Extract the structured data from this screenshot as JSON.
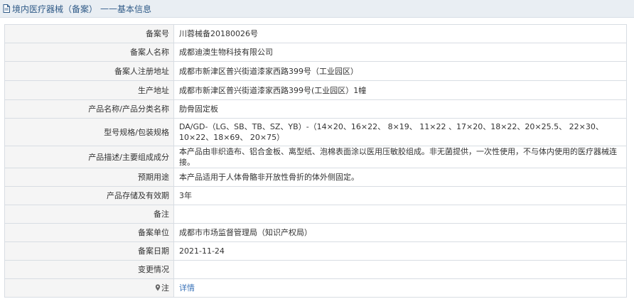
{
  "header": {
    "section": "境内医疗器械（备案）",
    "separator": "——",
    "subtitle": "基本信息"
  },
  "rows": [
    {
      "label": "备案号",
      "value": "川蓉械备20180026号"
    },
    {
      "label": "备案人名称",
      "value": "成都迪澳生物科技有限公司"
    },
    {
      "label": "备案人注册地址",
      "value": "成都市新津区普兴街道漆家西路399号（工业园区）"
    },
    {
      "label": "生产地址",
      "value": "成都市新津区普兴街道漆家西路399号(工业园区）1幢"
    },
    {
      "label": "产品名称/产品分类名称",
      "value": "肋骨固定板"
    },
    {
      "label": "型号规格/包装规格",
      "value": "DA/GD-（LG、SB、TB、SZ、YB）-（14×20、16×22、 8×19、 11×22 、17×20、18×22、20×25.5、 22×30、 10×22、18×69、 20×75）"
    },
    {
      "label": "产品描述/主要组成成分",
      "value": "本产品由非织造布、铝合金板、离型纸、泡棉表面涂以医用压敏胶组成。非无菌提供，一次性使用，不与体内使用的医疗器械连接。"
    },
    {
      "label": "预期用途",
      "value": "本产品适用于人体骨骼非开放性骨折的体外侧固定。"
    },
    {
      "label": "产品存储及有效期",
      "value": "3年"
    },
    {
      "label": "备注",
      "value": ""
    },
    {
      "label": "备案单位",
      "value": "成都市市场监督管理局（知识产权局）"
    },
    {
      "label": "备案日期",
      "value": "2021-11-24"
    },
    {
      "label": "变更情况",
      "value": ""
    }
  ],
  "note": {
    "label": "注",
    "link": "详情",
    "icon": "pin-icon"
  },
  "colors": {
    "header_bg": "#e9eef3",
    "header_text": "#2f5a87",
    "label_bg": "#f5f5f5",
    "border": "#d8dde3",
    "link": "#3a73b8"
  }
}
